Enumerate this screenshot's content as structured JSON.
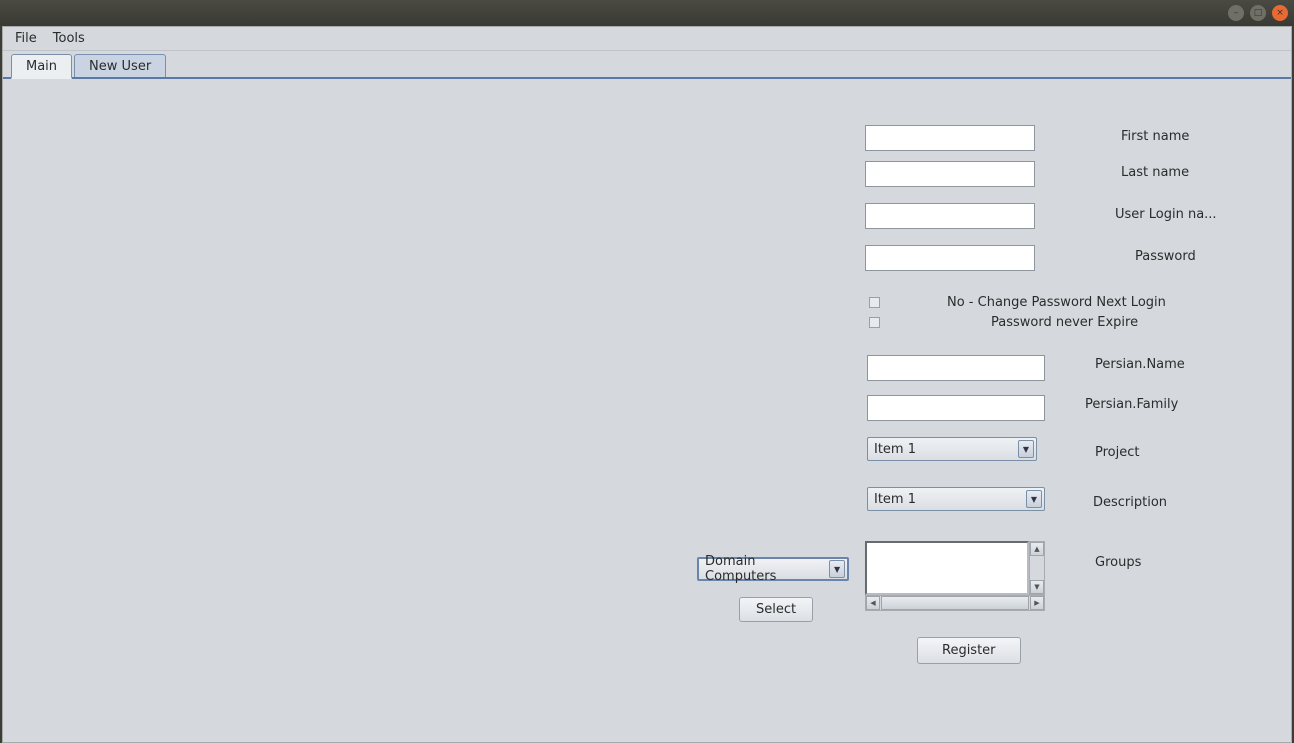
{
  "menubar": {
    "file": "File",
    "tools": "Tools"
  },
  "tabs": {
    "main": "Main",
    "newuser": "New User"
  },
  "form": {
    "first_name": {
      "label": "First name",
      "value": ""
    },
    "last_name": {
      "label": "Last name",
      "value": ""
    },
    "login_name": {
      "label": "User Login na...",
      "value": ""
    },
    "password": {
      "label": "Password",
      "value": ""
    },
    "no_change_pw": {
      "label": "No - Change Password Next Login",
      "checked": false
    },
    "never_expire": {
      "label": "Password never Expire",
      "checked": false
    },
    "persian_name": {
      "label": "Persian.Name",
      "value": ""
    },
    "persian_family": {
      "label": "Persian.Family",
      "value": ""
    },
    "project": {
      "label": "Project",
      "value": "Item 1"
    },
    "description": {
      "label": "Description",
      "value": "Item 1"
    },
    "groups": {
      "label": "Groups"
    },
    "domain_combo": {
      "value": "Domain Computers"
    },
    "select_btn": "Select",
    "register_btn": "Register"
  }
}
